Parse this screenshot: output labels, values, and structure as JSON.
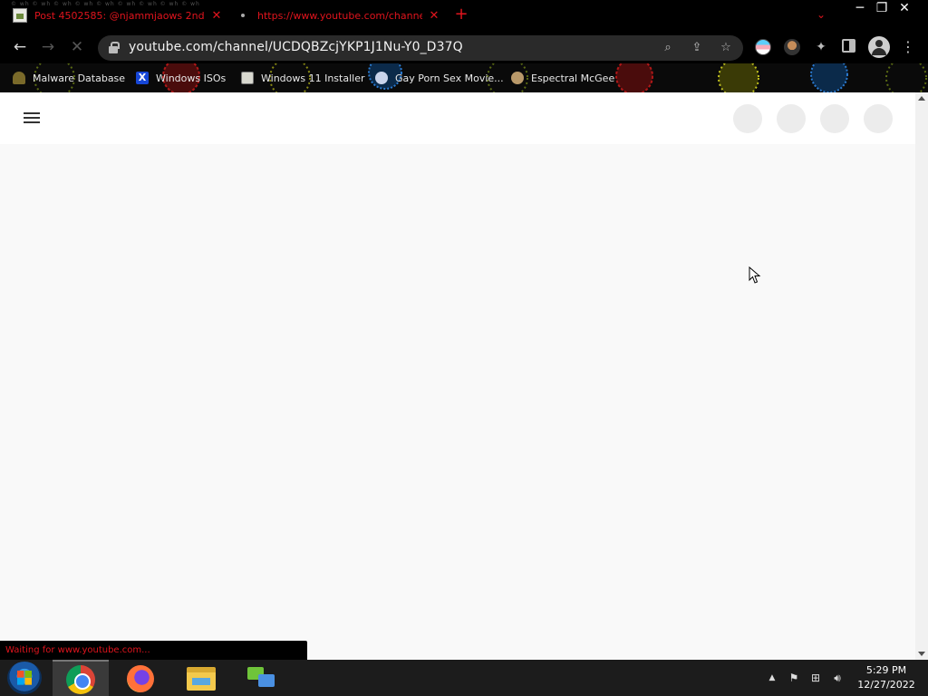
{
  "browser": {
    "tabs": [
      {
        "title": "Post 4502585: @njammjaows 2nd",
        "close": "✕"
      },
      {
        "title": "https://www.youtube.com/channe",
        "close": "✕"
      }
    ],
    "new_tab_icon": "plus-icon",
    "tab_search_icon": "chevron-down-icon",
    "window_controls": {
      "minimize": "─",
      "maximize": "❐",
      "close": "✕"
    },
    "tab_noise_text": "© wh   © wh   © wh   © wh   © wh   © wh   © wh   © wh   © wh"
  },
  "toolbar": {
    "url": "youtube.com/channel/UCDQBZcjYKP1J1Nu-Y0_D37Q",
    "back_icon": "arrow-left-icon",
    "forward_icon": "arrow-right-icon",
    "reload_icon": "stop-loading-icon",
    "menu_icon": "⋮"
  },
  "bookmarks": [
    {
      "label": "Malware Database"
    },
    {
      "label": "Windows ISOs",
      "icon_text": "X"
    },
    {
      "label": "Windows 11 Installer"
    },
    {
      "label": "Gay Porn Sex Movie..."
    },
    {
      "label": "Espectral McGee"
    }
  ],
  "page": {
    "status_text": "Waiting for www.youtube.com...",
    "header_placeholders": 4
  },
  "taskbar": {
    "apps": [
      "start",
      "chrome",
      "firefox",
      "file-explorer",
      "network-app"
    ],
    "clock": {
      "time": "5:29 PM",
      "date": "12/27/2022"
    }
  },
  "colors": {
    "tab_text": "#e0141d",
    "browser_chrome": "#000000",
    "page_bg": "#f9f9f9",
    "taskbar": "#1c1c1c"
  }
}
